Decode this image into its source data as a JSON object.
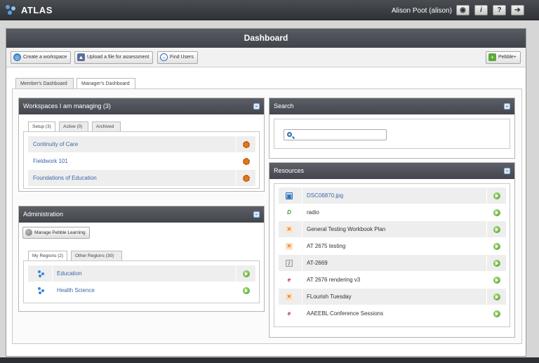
{
  "app": {
    "name": "ATLAS",
    "user": "Alison Poot (alison)"
  },
  "topbar": {
    "buttons": [
      {
        "icon": "view-icon",
        "glyph": "◉"
      },
      {
        "icon": "info-icon",
        "glyph": "i"
      },
      {
        "icon": "help-icon",
        "glyph": "?"
      },
      {
        "icon": "logout-icon",
        "glyph": "➔"
      }
    ]
  },
  "dashboard": {
    "title": "Dashboard"
  },
  "toolbar": {
    "create_workspace": "Create a workspace",
    "upload_file": "Upload a file for assessment",
    "find_users": "Find Users",
    "pebble_plus": "Pebble+"
  },
  "dash_tabs": {
    "member": "Member's Dashboard",
    "manager": "Manager's Dashboard"
  },
  "workspaces": {
    "title": "Workspaces I am managing (3)",
    "tabs": {
      "setup": "Setup (3)",
      "active": "Active (0)",
      "archived": "Archived"
    },
    "items": [
      {
        "label": "Continuity of Care"
      },
      {
        "label": "Fieldwork 101"
      },
      {
        "label": "Foundations of Education"
      }
    ]
  },
  "administration": {
    "title": "Administration",
    "manage_button": "Manage Pebble Learning",
    "tabs": {
      "my_regions": "My Regions (2)",
      "other_regions": "Other Regions (30)"
    },
    "regions": [
      {
        "label": "Education"
      },
      {
        "label": "Health Science"
      }
    ]
  },
  "search": {
    "title": "Search",
    "value": ""
  },
  "resources": {
    "title": "Resources",
    "items": [
      {
        "label": "DSC06870.jpg",
        "icon": "image-file-icon",
        "glyph": "▣",
        "color": "#2d6fb5",
        "link": true
      },
      {
        "label": "radio",
        "icon": "page-icon",
        "glyph": "D",
        "color": "#3a9a3a",
        "link": false
      },
      {
        "label": "General Testing Workbook Plan",
        "icon": "workbook-icon",
        "glyph": "✕",
        "color": "#e07a1f",
        "link": false
      },
      {
        "label": "AT 2675 testing",
        "icon": "workbook-icon",
        "glyph": "✕",
        "color": "#e07a1f",
        "link": false
      },
      {
        "label": "AT-2669",
        "icon": "form-icon",
        "glyph": "/",
        "color": "#777777",
        "link": false
      },
      {
        "label": "AT 2676 rendering v3",
        "icon": "webfolio-icon",
        "glyph": "e",
        "color": "#c0303a",
        "link": false
      },
      {
        "label": "FLourish Tuesday",
        "icon": "workbook-icon",
        "glyph": "✕",
        "color": "#e07a1f",
        "link": false
      },
      {
        "label": "AAEEBL Conference Sessions",
        "icon": "webfolio-icon",
        "glyph": "e",
        "color": "#c0303a",
        "link": false
      }
    ]
  }
}
